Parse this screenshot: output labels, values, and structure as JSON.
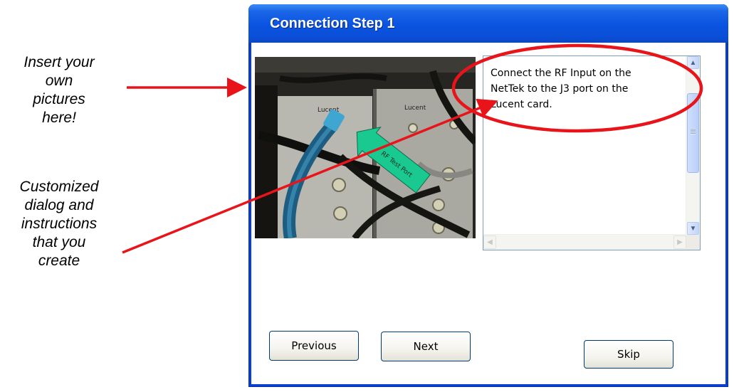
{
  "annotations": {
    "pictures_callout": [
      "Insert your",
      "own",
      "pictures",
      "here!"
    ],
    "dialog_callout": [
      "Customized",
      "dialog and",
      "instructions",
      "that you",
      "create"
    ]
  },
  "dialog": {
    "title": "Connection Step 1",
    "instructions_lines": [
      "Connect the RF Input on the",
      "NetTek to the J3 port on the",
      "Lucent card."
    ],
    "photo_labels": {
      "card_left": "Lucent",
      "card_right": "Lucent",
      "arrow_text": "RF Test Port"
    },
    "buttons": {
      "previous": "Previous",
      "next": "Next",
      "skip": "Skip"
    }
  },
  "colors": {
    "titlebar": "#0a53e0",
    "annotation_red": "#e8141a",
    "arrow_green": "#19c98f"
  },
  "icons": {
    "scroll_up": "scroll-up-arrow-icon",
    "scroll_down": "scroll-down-arrow-icon",
    "scroll_left": "scroll-left-arrow-icon",
    "scroll_right": "scroll-right-arrow-icon"
  }
}
